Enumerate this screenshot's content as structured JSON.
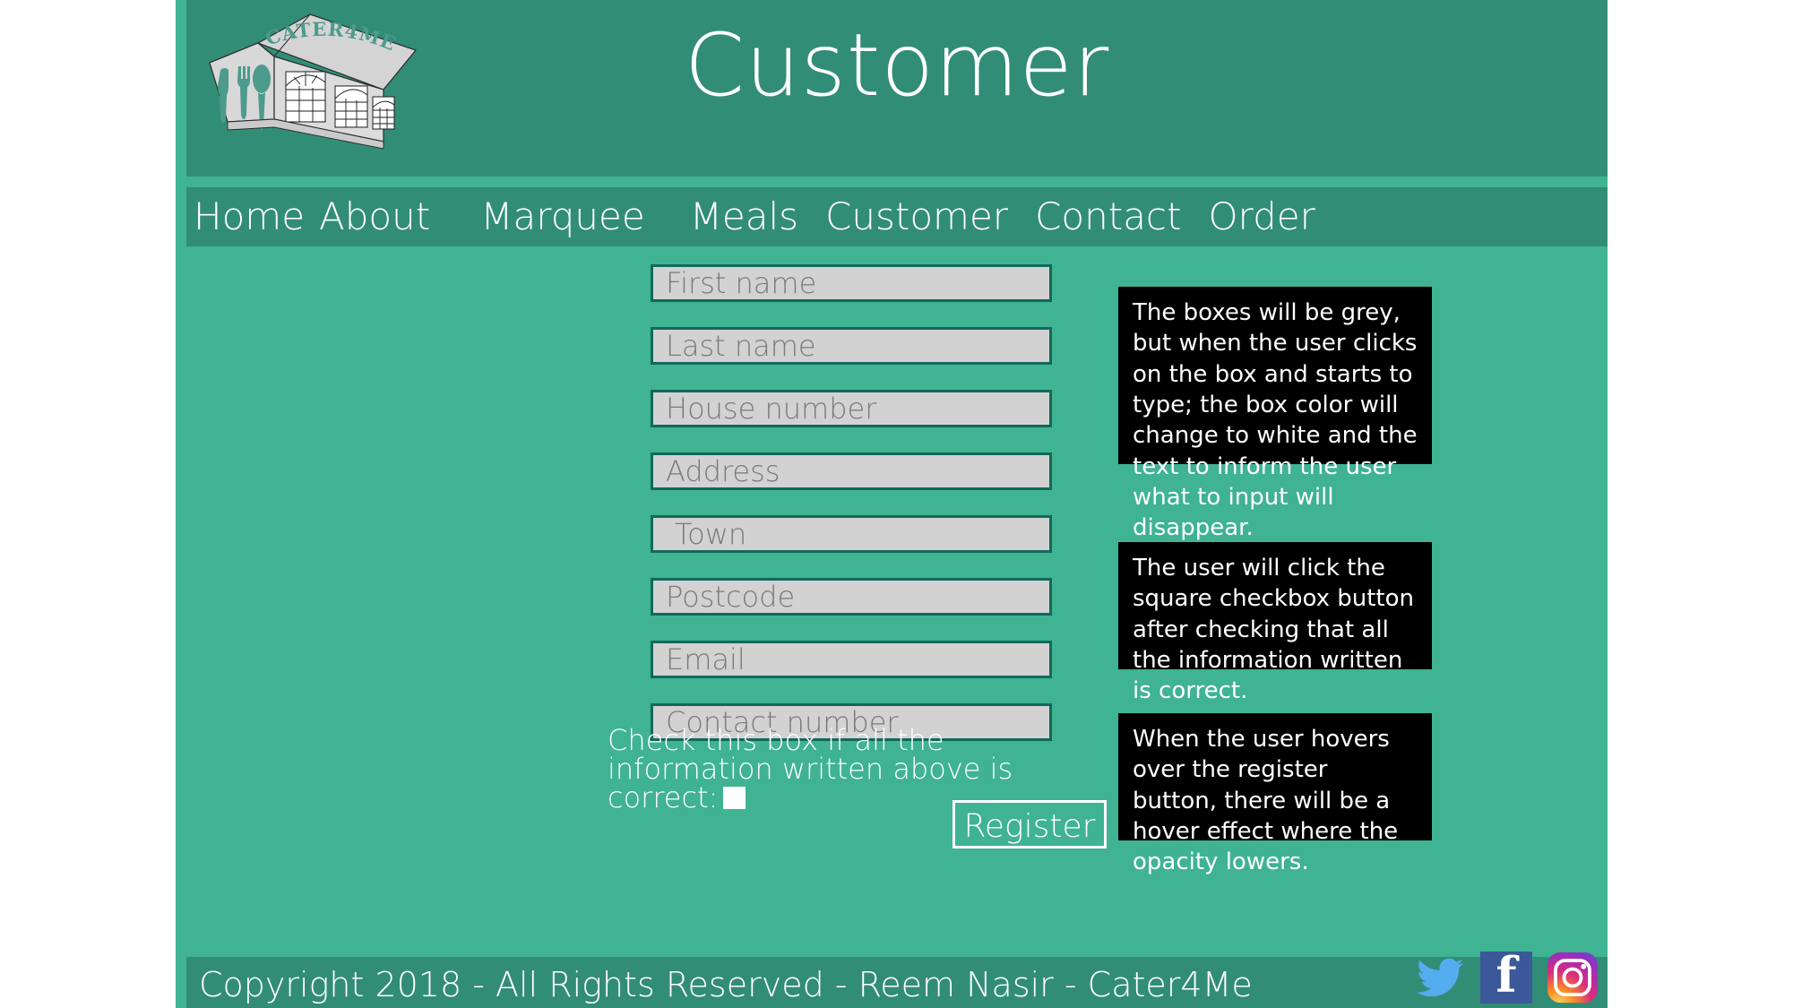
{
  "colors": {
    "page_bg": "#3fb392",
    "header_bg": "#328d76",
    "field_bg": "#d2d2d2",
    "field_border": "#12695a",
    "note_bg": "#000000",
    "text_white": "#ffffff",
    "twitter": "#55acee",
    "facebook": "#3b5998",
    "instagram_start": "#f9ce34"
  },
  "header": {
    "title": "Customer",
    "logo_text": "CATER4ME",
    "logo_alt": "marquee-tent-logo"
  },
  "nav": {
    "items": [
      {
        "label": "Home"
      },
      {
        "label": "About"
      },
      {
        "label": "Marquee"
      },
      {
        "label": "Meals"
      },
      {
        "label": "Customer"
      },
      {
        "label": "Contact"
      },
      {
        "label": "Order"
      }
    ]
  },
  "form": {
    "fields": [
      {
        "name": "first-name",
        "placeholder": "First name",
        "value": ""
      },
      {
        "name": "last-name",
        "placeholder": "Last name",
        "value": ""
      },
      {
        "name": "house-number",
        "placeholder": "House number",
        "value": ""
      },
      {
        "name": "address",
        "placeholder": "Address",
        "value": ""
      },
      {
        "name": "town",
        "placeholder": "Town",
        "value": ""
      },
      {
        "name": "postcode",
        "placeholder": "Postcode",
        "value": ""
      },
      {
        "name": "email",
        "placeholder": "Email",
        "value": ""
      },
      {
        "name": "contact-number",
        "placeholder": "Contact number",
        "value": ""
      }
    ],
    "checkbox_label": "Check this box if all the information written above is correct:",
    "checkbox_checked": false,
    "register_label": "Register"
  },
  "notes": [
    {
      "id": "note-1",
      "text": "The boxes will be grey, but when the user clicks on the box and starts to type; the box color will change to white and the text to inform the user what to input will disappear."
    },
    {
      "id": "note-2",
      "text": "The user will click the square checkbox button after checking that all the information written is correct."
    },
    {
      "id": "note-3",
      "text": "When the user hovers over the register button, there will be a hover effect where the opacity lowers."
    }
  ],
  "footer": {
    "copyright": "Copyright 2018 - All Rights Reserved - Reem Nasir - Cater4Me",
    "social": [
      {
        "name": "twitter-icon",
        "label": "Twitter"
      },
      {
        "name": "facebook-icon",
        "label": "Facebook"
      },
      {
        "name": "instagram-icon",
        "label": "Instagram"
      }
    ]
  }
}
